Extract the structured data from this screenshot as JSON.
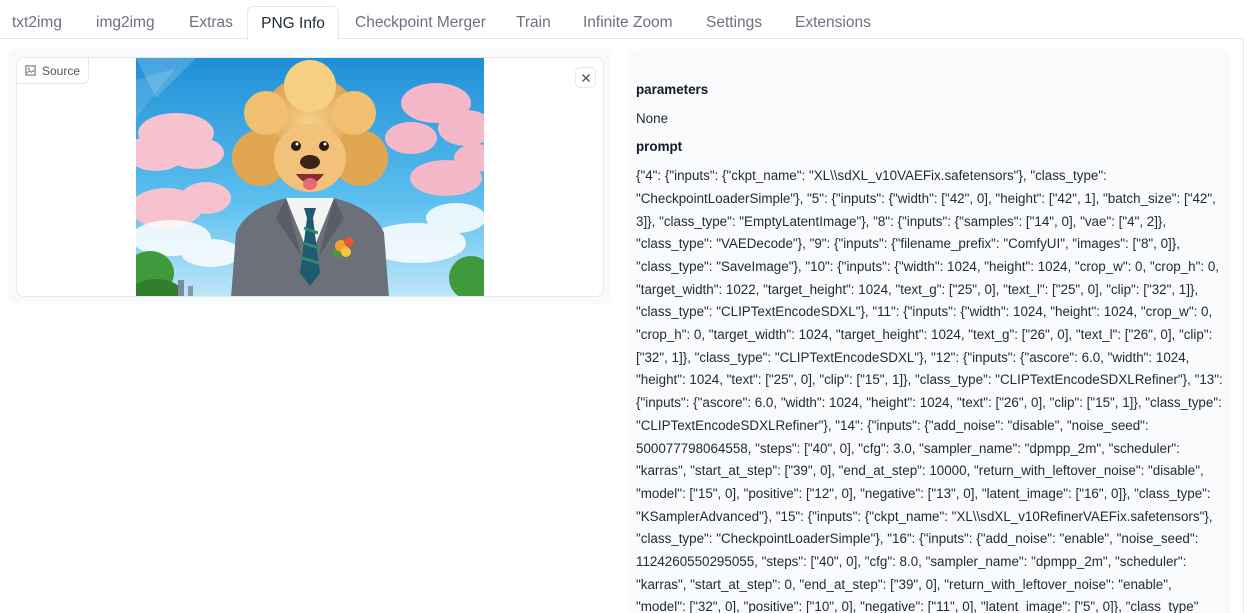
{
  "tabs": [
    {
      "label": "txt2img"
    },
    {
      "label": "img2img"
    },
    {
      "label": "Extras"
    },
    {
      "label": "PNG Info"
    },
    {
      "label": "Checkpoint Merger"
    },
    {
      "label": "Train"
    },
    {
      "label": "Infinite Zoom"
    },
    {
      "label": "Settings"
    },
    {
      "label": "Extensions"
    }
  ],
  "active_tab": "PNG Info",
  "source": {
    "label": "Source",
    "icon": "image-icon",
    "clear_icon": "close-icon"
  },
  "info": {
    "parameters_heading": "parameters",
    "parameters_value": "None",
    "prompt_heading": "prompt",
    "prompt_value": "{\"4\": {\"inputs\": {\"ckpt_name\": \"XL\\\\sdXL_v10VAEFix.safetensors\"}, \"class_type\": \"CheckpointLoaderSimple\"}, \"5\": {\"inputs\": {\"width\": [\"42\", 0], \"height\": [\"42\", 1], \"batch_size\": [\"42\", 3]}, \"class_type\": \"EmptyLatentImage\"}, \"8\": {\"inputs\": {\"samples\": [\"14\", 0], \"vae\": [\"4\", 2]}, \"class_type\": \"VAEDecode\"}, \"9\": {\"inputs\": {\"filename_prefix\": \"ComfyUI\", \"images\": [\"8\", 0]}, \"class_type\": \"SaveImage\"}, \"10\": {\"inputs\": {\"width\": 1024, \"height\": 1024, \"crop_w\": 0, \"crop_h\": 0, \"target_width\": 1022, \"target_height\": 1024, \"text_g\": [\"25\", 0], \"text_l\": [\"25\", 0], \"clip\": [\"32\", 1]}, \"class_type\": \"CLIPTextEncodeSDXL\"}, \"11\": {\"inputs\": {\"width\": 1024, \"height\": 1024, \"crop_w\": 0, \"crop_h\": 0, \"target_width\": 1024, \"target_height\": 1024, \"text_g\": [\"26\", 0], \"text_l\": [\"26\", 0], \"clip\": [\"32\", 1]}, \"class_type\": \"CLIPTextEncodeSDXL\"}, \"12\": {\"inputs\": {\"ascore\": 6.0, \"width\": 1024, \"height\": 1024, \"text\": [\"25\", 0], \"clip\": [\"15\", 1]}, \"class_type\": \"CLIPTextEncodeSDXLRefiner\"}, \"13\": {\"inputs\": {\"ascore\": 6.0, \"width\": 1024, \"height\": 1024, \"text\": [\"26\", 0], \"clip\": [\"15\", 1]}, \"class_type\": \"CLIPTextEncodeSDXLRefiner\"}, \"14\": {\"inputs\": {\"add_noise\": \"disable\", \"noise_seed\": 500077798064558, \"steps\": [\"40\", 0], \"cfg\": 3.0, \"sampler_name\": \"dpmpp_2m\", \"scheduler\": \"karras\", \"start_at_step\": [\"39\", 0], \"end_at_step\": 10000, \"return_with_leftover_noise\": \"disable\", \"model\": [\"15\", 0], \"positive\": [\"12\", 0], \"negative\": [\"13\", 0], \"latent_image\": [\"16\", 0]}, \"class_type\": \"KSamplerAdvanced\"}, \"15\": {\"inputs\": {\"ckpt_name\": \"XL\\\\sdXL_v10RefinerVAEFix.safetensors\"}, \"class_type\": \"CheckpointLoaderSimple\"}, \"16\": {\"inputs\": {\"add_noise\": \"enable\", \"noise_seed\": 1124260550295055, \"steps\": [\"40\", 0], \"cfg\": 8.0, \"sampler_name\": \"dpmpp_2m\", \"scheduler\": \"karras\", \"start_at_step\": 0, \"end_at_step\": [\"39\", 0], \"return_with_leftover_noise\": \"enable\", \"model\": [\"32\", 0], \"positive\": [\"10\", 0], \"negative\": [\"11\", 0], \"latent_image\": [\"5\", 0]}, \"class_type\""
  },
  "colors": {
    "panel_bg": "#f9fafb",
    "border": "#e5e7eb",
    "active_tab_text": "#1f2937",
    "inactive_tab_text": "#6b7280"
  }
}
